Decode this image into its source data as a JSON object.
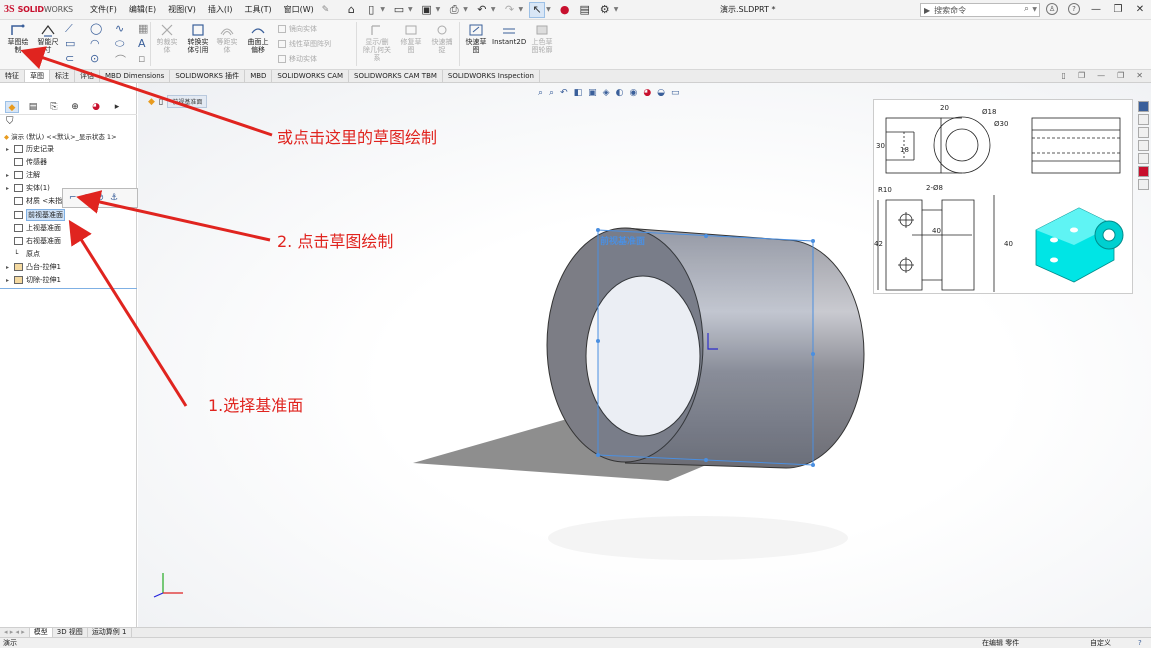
{
  "app": {
    "logo_mark": "3S",
    "brand_bold": "SOLID",
    "brand_light": "WORKS"
  },
  "menu": [
    "文件(F)",
    "编辑(E)",
    "视图(V)",
    "插入(I)",
    "工具(T)",
    "窗口(W)"
  ],
  "document_title": "演示.SLDPRT *",
  "search": {
    "placeholder": "搜索命令"
  },
  "ribbon": {
    "sketch": "草图绘制",
    "smart_dim": "智能尺寸",
    "trim": "剪裁实体",
    "convert": "转换实体引用",
    "offset": "等距实体",
    "surface_offset": "曲面上偏移",
    "mirror": "镜向实体",
    "linear_pattern": "线性草图阵列",
    "move": "移动实体",
    "display_relations": "显示/删除几何关系",
    "repair": "修复草图",
    "quick_snaps": "快速捕捉",
    "rapid_sketch": "快速草图",
    "instant2d": "Instant2D",
    "shaded_sketch": "上色草图轮廓"
  },
  "tabs": [
    "特征",
    "草图",
    "标注",
    "评估",
    "MBD Dimensions",
    "SOLIDWORKS 插件",
    "MBD",
    "SOLIDWORKS CAM",
    "SOLIDWORKS CAM TBM",
    "SOLIDWORKS Inspection"
  ],
  "feature_tree": {
    "root": "演示 (默认) <<默认>_显示状态 1>",
    "items": [
      {
        "label": "历史记录",
        "expandable": true
      },
      {
        "label": "传感器",
        "expandable": false
      },
      {
        "label": "注解",
        "expandable": true
      },
      {
        "label": "实体(1)",
        "expandable": true
      },
      {
        "label": "材质 <未指定>",
        "expandable": false
      },
      {
        "label": "前视基准面",
        "expandable": false,
        "selected": true
      },
      {
        "label": "上视基准面",
        "expandable": false
      },
      {
        "label": "右视基准面",
        "expandable": false
      },
      {
        "label": "原点",
        "expandable": false
      },
      {
        "label": "凸台-拉伸1",
        "expandable": true
      },
      {
        "label": "切除-拉伸1",
        "expandable": true
      }
    ]
  },
  "viewport": {
    "breadcrumb_selection": "前视基准面",
    "plane_label": "前视基准面"
  },
  "drawing_dims": {
    "d1": "20",
    "d2": "Ø18",
    "d3": "Ø30",
    "d4": "30",
    "d5": "18",
    "d6": "R10",
    "d7": "2-Ø8",
    "d8": "40",
    "d9": "42",
    "d10": "40"
  },
  "annotations": {
    "a1": "或点击这里的草图绘制",
    "a2": "2. 点击草图绘制",
    "a3": "1.选择基准面"
  },
  "bottom_tabs": [
    "模型",
    "3D 视图",
    "运动算例 1"
  ],
  "status": {
    "left": "演示",
    "middle": "在编辑 零件",
    "right": "自定义"
  },
  "colors": {
    "annotation": "#e0241f",
    "part_face": "#7c7d85",
    "preview": "#00e5e5",
    "plane": "#4b8fe0"
  }
}
